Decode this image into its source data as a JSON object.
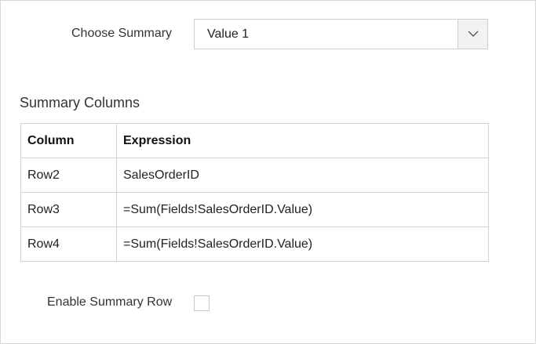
{
  "summary": {
    "label": "Choose Summary",
    "selected": "Value 1"
  },
  "summary_columns": {
    "title": "Summary Columns",
    "headers": [
      "Column",
      "Expression"
    ],
    "rows": [
      {
        "column": "Row2",
        "expression": "SalesOrderID"
      },
      {
        "column": "Row3",
        "expression": "=Sum(Fields!SalesOrderID.Value)"
      },
      {
        "column": "Row4",
        "expression": "=Sum(Fields!SalesOrderID.Value)"
      }
    ]
  },
  "enable_summary_row": {
    "label": "Enable Summary Row",
    "checked": false
  },
  "icons": {
    "dropdown": "chevron-down-icon"
  }
}
